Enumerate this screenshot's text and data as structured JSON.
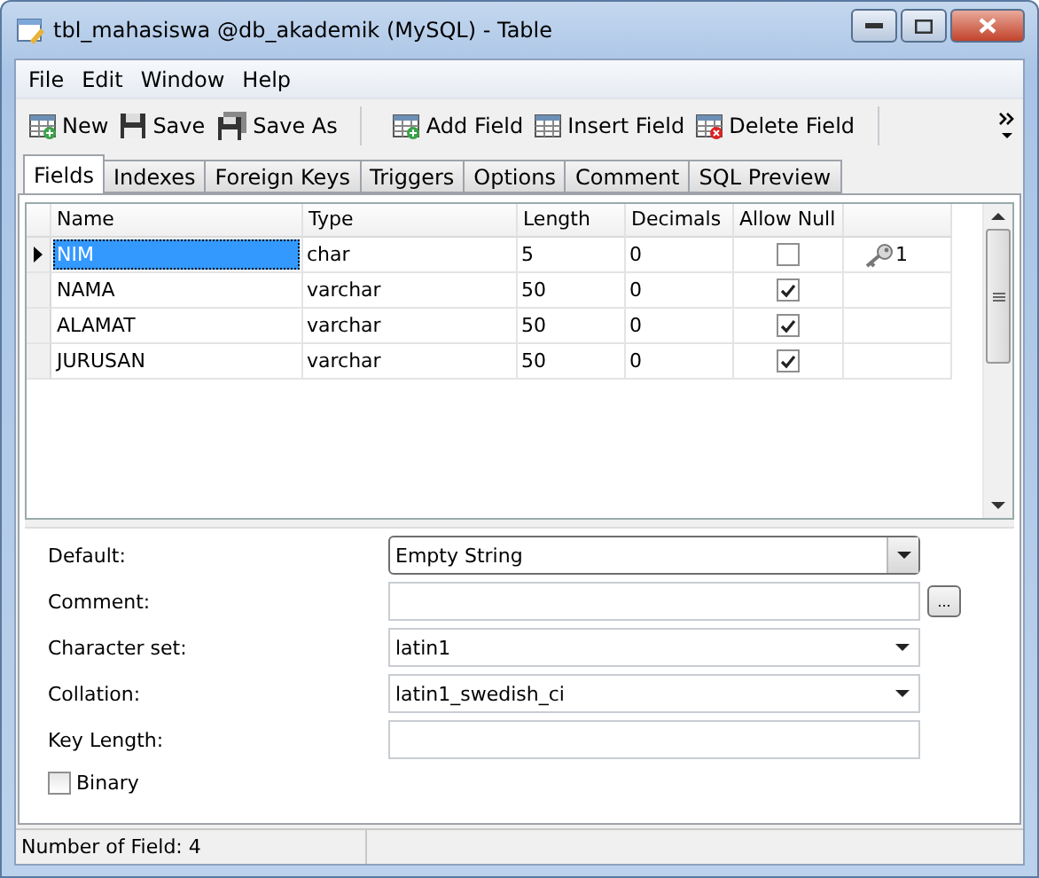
{
  "window": {
    "title": "tbl_mahasiswa @db_akademik (MySQL) - Table"
  },
  "menu": [
    "File",
    "Edit",
    "Window",
    "Help"
  ],
  "toolbar": [
    {
      "label": "New",
      "kind": "new"
    },
    {
      "label": "Save",
      "kind": "save"
    },
    {
      "label": "Save As",
      "kind": "saveas"
    },
    {
      "label": "Add Field",
      "kind": "add",
      "group_start": true
    },
    {
      "label": "Insert Field",
      "kind": "insert"
    },
    {
      "label": "Delete Field",
      "kind": "delete"
    }
  ],
  "tabs": [
    {
      "label": "Fields",
      "selected": true
    },
    {
      "label": "Indexes",
      "selected": false
    },
    {
      "label": "Foreign Keys",
      "selected": false
    },
    {
      "label": "Triggers",
      "selected": false
    },
    {
      "label": "Options",
      "selected": false
    },
    {
      "label": "Comment",
      "selected": false
    },
    {
      "label": "SQL Preview",
      "selected": false
    }
  ],
  "table": {
    "columns": [
      "Name",
      "Type",
      "Length",
      "Decimals",
      "Allow Null"
    ],
    "rows": [
      {
        "name": "NIM",
        "type": "char",
        "length": "5",
        "decimals": "0",
        "allow_null": false,
        "key": "1",
        "selected": true
      },
      {
        "name": "NAMA",
        "type": "varchar",
        "length": "50",
        "decimals": "0",
        "allow_null": true,
        "selected": false
      },
      {
        "name": "ALAMAT",
        "type": "varchar",
        "length": "50",
        "decimals": "0",
        "allow_null": true,
        "selected": false
      },
      {
        "name": "JURUSAN",
        "type": "varchar",
        "length": "50",
        "decimals": "0",
        "allow_null": true,
        "selected": false
      }
    ]
  },
  "properties": [
    {
      "label": "Default:",
      "kind": "combo",
      "value": "Empty String"
    },
    {
      "label": "Comment:",
      "kind": "text",
      "more_button": "..."
    },
    {
      "label": "Character set:",
      "kind": "dropdown",
      "value": "latin1"
    },
    {
      "label": "Collation:",
      "kind": "dropdown",
      "value": "latin1_swedish_ci"
    },
    {
      "label": "Key Length:",
      "kind": "text"
    }
  ],
  "binary": {
    "label": "Binary",
    "checked": false
  },
  "status_bar": "Number of Field: 4"
}
